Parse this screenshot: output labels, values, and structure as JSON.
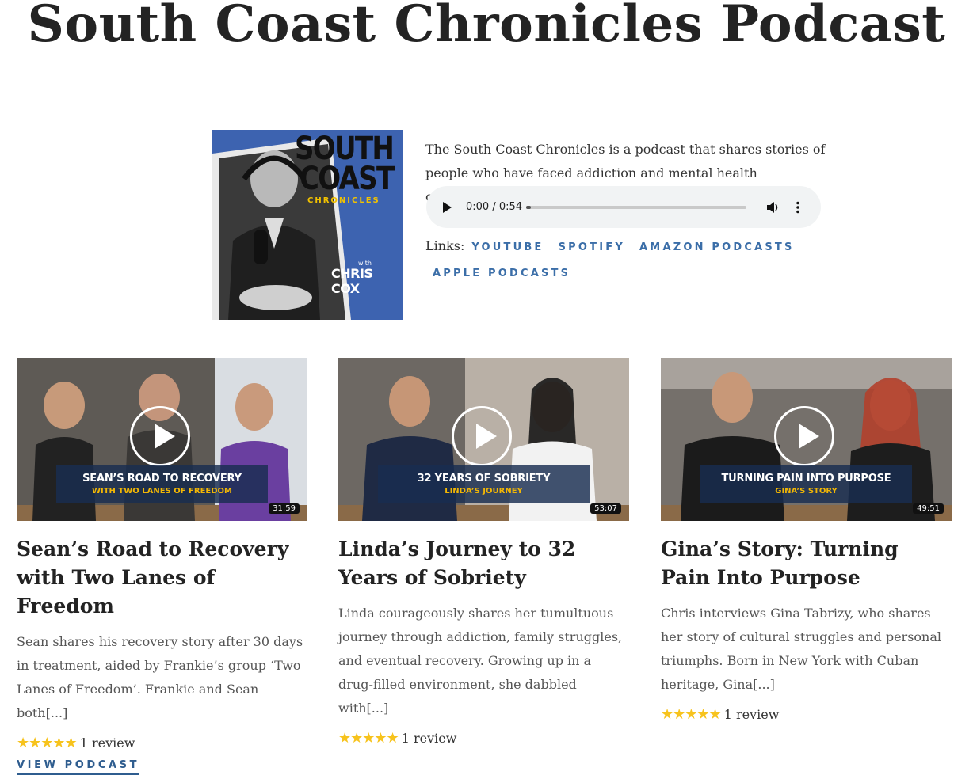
{
  "header": {
    "title": "South Coast Chronicles Podcast"
  },
  "cover": {
    "line1": "SOUTH",
    "line2": "COAST",
    "line3": "CHRONICLES",
    "with": "with",
    "host": "CHRIS COX"
  },
  "intro": {
    "text": "The South Coast Chronicles is a podcast that shares stories of people who have faced addiction and mental health challenges."
  },
  "player": {
    "time": "0:00 / 0:54",
    "progress": 0.0
  },
  "links": {
    "label": "Links:",
    "items": [
      "YOUTUBE",
      "SPOTIFY",
      "AMAZON PODCASTS",
      "APPLE PODCASTS"
    ]
  },
  "episodes": [
    {
      "overlay_title": "SEAN’S ROAD TO RECOVERY",
      "overlay_sub": "WITH TWO LANES OF FREEDOM",
      "duration": "31:59",
      "title": "Sean’s Road to Recovery with Two Lanes of Freedom",
      "excerpt": "Sean shares his recovery story after 30 days in treatment, aided by Frankie’s group ‘Two Lanes of Freedom’. Frankie and Sean both[...]",
      "stars": "★★★★★",
      "reviews": "1 review",
      "view_label": "VIEW PODCAST"
    },
    {
      "overlay_title": "32 YEARS OF SOBRIETY",
      "overlay_sub": "LINDA’S JOURNEY",
      "duration": "53:07",
      "title": "Linda’s Journey to 32 Years of Sobriety",
      "excerpt": "Linda courageously shares her tumultuous journey through addiction, family struggles, and eventual recovery. Growing up in a drug-filled environment, she dabbled with[...]",
      "stars": "★★★★★",
      "reviews": "1 review"
    },
    {
      "overlay_title": "TURNING PAIN INTO PURPOSE",
      "overlay_sub": "GINA’S STORY",
      "duration": "49:51",
      "title": "Gina’s Story: Turning Pain Into Purpose",
      "excerpt": "Chris interviews Gina Tabrizy, who shares her story of cultural struggles and personal triumphs. Born in New York with Cuban heritage, Gina[...]",
      "stars": "★★★★★",
      "reviews": "1 review"
    }
  ],
  "rating": 5,
  "colors": {
    "accent": "#3b6ea8",
    "star": "#f7c31d",
    "overlay_sub": "#f2b705"
  }
}
